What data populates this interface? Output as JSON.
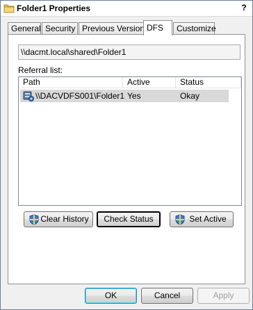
{
  "window": {
    "title": "Folder1 Properties",
    "help_glyph": "?"
  },
  "tabs": [
    {
      "label": "General",
      "active": false
    },
    {
      "label": "Security",
      "active": false
    },
    {
      "label": "Previous Versions",
      "active": false
    },
    {
      "label": "DFS",
      "active": true
    },
    {
      "label": "Customize",
      "active": false
    }
  ],
  "dfs": {
    "namespace_path": "\\\\dacmt.local\\shared\\Folder1",
    "referral_label": "Referral list:",
    "columns": [
      "Path",
      "Active",
      "Status"
    ],
    "rows": [
      {
        "path": "\\\\DACVDFS001\\Folder1",
        "active": "Yes",
        "status": "Okay",
        "icon": "server-share-icon",
        "selected": true
      }
    ],
    "buttons": {
      "clear_history": "Clear History",
      "check_status": "Check Status",
      "set_active": "Set Active"
    }
  },
  "footer": {
    "ok": "OK",
    "cancel": "Cancel",
    "apply": "Apply"
  },
  "colors": {
    "selected_row": "#d9d9d9",
    "window_bg": "#f0f0f0",
    "panel_bg": "#ffffff"
  }
}
